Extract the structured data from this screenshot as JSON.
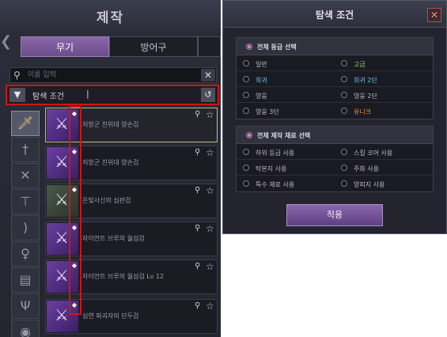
{
  "craft_panel": {
    "title": "제작",
    "tabs": [
      {
        "label": "무기",
        "active": true
      },
      {
        "label": "방어구",
        "active": false
      },
      {
        "label": "",
        "active": false
      }
    ],
    "search": {
      "placeholder": "이름 입력",
      "value": ""
    },
    "filter": {
      "label": "탐색 조건",
      "cursor": "|"
    },
    "categories": [
      {
        "icon": "sword-icon",
        "active": true
      },
      {
        "icon": "dagger-icon",
        "active": false
      },
      {
        "icon": "dual-blades-icon",
        "active": false
      },
      {
        "icon": "crossbow-icon",
        "active": false
      },
      {
        "icon": "bow-icon",
        "active": false
      },
      {
        "icon": "staff-icon",
        "active": false
      },
      {
        "icon": "spellbook-icon",
        "active": false
      },
      {
        "icon": "trident-icon",
        "active": false
      },
      {
        "icon": "orb-icon",
        "active": false
      }
    ],
    "items": [
      {
        "name": "저항군 친위대 양손검",
        "selected": true
      },
      {
        "name": "저항군 친위대 양손검",
        "selected": false
      },
      {
        "name": "은빛사신의 심판검",
        "selected": false
      },
      {
        "name": "자이언트 브루의 월섬검",
        "selected": false
      },
      {
        "name": "자이언트 브루의 월섬검 Lv 12",
        "selected": false
      },
      {
        "name": "심연 파괴자의 단두검",
        "selected": false
      }
    ],
    "colors": {
      "highlight": "#d11414",
      "accent": "#7a58a0"
    }
  },
  "dialog": {
    "title": "탐색 조건",
    "close_icon": "close-icon",
    "grade_section": {
      "title": "전체 등급 선택",
      "options": [
        {
          "label": "일반",
          "color": "#bdb9c6"
        },
        {
          "label": "고급",
          "color": "#8fd06c"
        },
        {
          "label": "희귀",
          "color": "#6fc3e8"
        },
        {
          "label": "희귀 2단",
          "color": "#6fc3e8"
        },
        {
          "label": "영웅",
          "color": "#bdb9c6"
        },
        {
          "label": "영웅 2단",
          "color": "#bdb9c6"
        },
        {
          "label": "영웅 3단",
          "color": "#bdb9c6"
        },
        {
          "label": "유니크",
          "color": "#e69a3c"
        }
      ]
    },
    "material_section": {
      "title": "전체 제작 재료 선택",
      "options": [
        {
          "label": "하위 등급 사용"
        },
        {
          "label": "스킬 코어 사용"
        },
        {
          "label": "탁본지 사용"
        },
        {
          "label": "주화 사용"
        },
        {
          "label": "특수 재료 사용"
        },
        {
          "label": "양피지 사용"
        }
      ]
    },
    "apply_label": "적용"
  }
}
